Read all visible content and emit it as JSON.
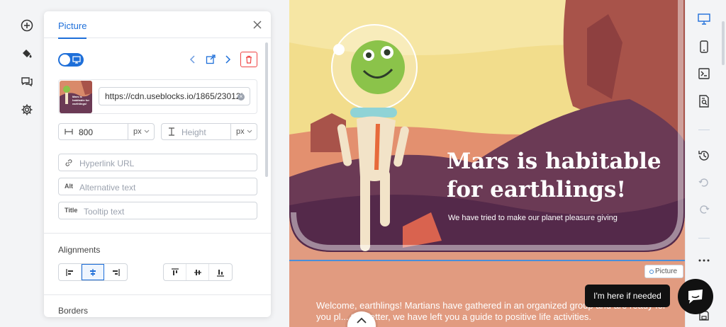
{
  "left_rail": {
    "icons": [
      "add-circle-icon",
      "paint-bucket-icon",
      "chat-icon",
      "settings-gear-icon"
    ]
  },
  "panel": {
    "tab_label": "Picture",
    "url_value": "https://cdn.useblocks.io/1865/23012!",
    "thumbnail_caption": "Mars is habitable for earthlings!",
    "width_value": "800",
    "width_unit": "px",
    "height_placeholder": "Height",
    "height_unit": "px",
    "hyperlink_placeholder": "Hyperlink URL",
    "alt_label": "Alt",
    "alt_placeholder": "Alternative text",
    "title_label": "Title",
    "title_placeholder": "Tooltip text",
    "alignments_label": "Alignments",
    "borders_label": "Borders"
  },
  "canvas": {
    "hero_title": "Mars is habitable for earthlings!",
    "hero_subtitle": "We have tried to make our planet pleasure giving",
    "picture_tag": "Picture",
    "welcome_text": "Welcome, earthlings! Martians have gathered in an organized group and are ready for you pl... this letter, we have left you a guide to positive life activities."
  },
  "help": {
    "bubble_text": "I'm here if needed"
  },
  "right_rail": {
    "icons": [
      "desktop-icon",
      "mobile-icon",
      "terminal-icon",
      "search-doc-icon",
      "history-icon",
      "undo-icon",
      "redo-icon",
      "more-icon",
      "save-icon"
    ]
  },
  "colors": {
    "accent": "#1e6fd9",
    "danger": "#ef4444",
    "canvas_bg": "#e19b80"
  }
}
